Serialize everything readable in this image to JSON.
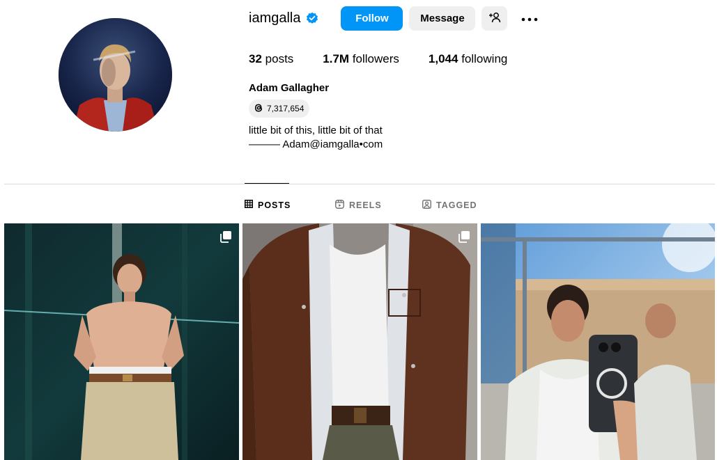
{
  "profile": {
    "username": "iamgalla",
    "follow_label": "Follow",
    "message_label": "Message",
    "stats": {
      "posts_count": "32",
      "posts_label": "posts",
      "followers_count": "1.7M",
      "followers_label": "followers",
      "following_count": "1,044",
      "following_label": "following"
    },
    "full_name": "Adam Gallagher",
    "threads_count": "7,317,654",
    "bio_line1": "little bit of this, little bit of that",
    "bio_line2": "——— Adam@iamgalla•com"
  },
  "tabs": [
    {
      "label": "POSTS",
      "active": true
    },
    {
      "label": "REELS",
      "active": false
    },
    {
      "label": "TAGGED",
      "active": false
    }
  ],
  "posts": [
    {
      "description": "shirtless portrait against dark green glass",
      "multi": true
    },
    {
      "description": "brown suede jacket over striped shirt",
      "multi": true
    },
    {
      "description": "mirror selfie outdoors with phone",
      "multi": false
    }
  ],
  "colors": {
    "accent": "#0095f6",
    "verified": "#0095f6",
    "secondary_bg": "#efefef",
    "muted_text": "#737373",
    "divider": "#dbdbdb"
  },
  "icons": {
    "verified": "verified-badge-icon",
    "suggest": "add-person-icon",
    "more": "more-options-icon",
    "threads": "threads-icon",
    "posts_tab": "grid-icon",
    "reels_tab": "reels-icon",
    "tagged_tab": "tagged-icon",
    "multi_post": "carousel-icon"
  }
}
